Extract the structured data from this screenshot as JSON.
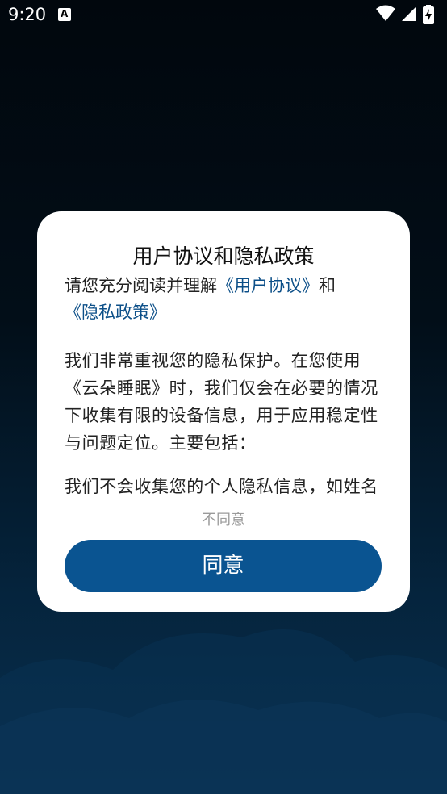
{
  "status_bar": {
    "time": "9:20",
    "notification_icon": "A"
  },
  "dialog": {
    "title": "用户协议和隐私政策",
    "intro_prefix": "请您充分阅读并理解",
    "user_agreement_link": "《用户协议》",
    "intro_and": "和",
    "privacy_policy_link": "《隐私政策》",
    "body_paragraph_1": "我们非常重视您的隐私保护。在您使用《云朵睡眠》时，我们仅会在必要的情况下收集有限的设备信息，用于应用稳定性与问题定位。主要包括：",
    "body_paragraph_2": "我们不会收集您的个人隐私信息，如姓名",
    "disagree_label": "不同意",
    "agree_label": "同意"
  },
  "colors": {
    "accent": "#0a5491",
    "link": "#0c4f88",
    "background_top": "#01070d",
    "background_bottom": "#08304f"
  },
  "icons": [
    "wifi-icon",
    "cell-signal-icon",
    "battery-charging-icon"
  ]
}
